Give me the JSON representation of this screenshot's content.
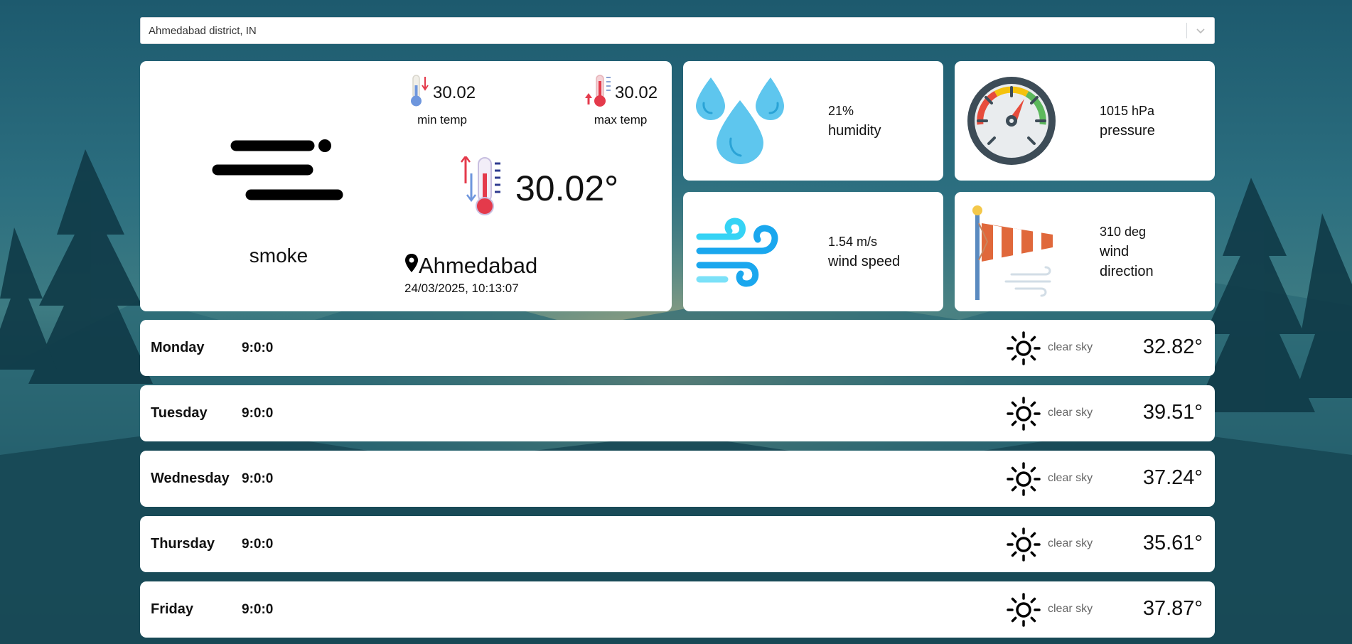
{
  "search": {
    "value": "Ahmedabad district, IN"
  },
  "current": {
    "condition": "smoke",
    "min_temp": "30.02",
    "min_label": "min temp",
    "max_temp": "30.02",
    "max_label": "max temp",
    "temp": "30.02°",
    "city": "Ahmedabad",
    "datetime": "24/03/2025, 10:13:07"
  },
  "tiles": {
    "humidity": {
      "value": "21%",
      "label": "humidity"
    },
    "pressure": {
      "value": "1015 hPa",
      "label": "pressure"
    },
    "wind_speed": {
      "value": "1.54 m/s",
      "label": "wind speed"
    },
    "wind_direction": {
      "value": "310 deg",
      "label_line1": "wind",
      "label_line2": "direction"
    }
  },
  "forecast": [
    {
      "day": "Monday",
      "time": "9:0:0",
      "desc": "clear sky",
      "temp": "32.82°"
    },
    {
      "day": "Tuesday",
      "time": "9:0:0",
      "desc": "clear sky",
      "temp": "39.51°"
    },
    {
      "day": "Wednesday",
      "time": "9:0:0",
      "desc": "clear sky",
      "temp": "37.24°"
    },
    {
      "day": "Thursday",
      "time": "9:0:0",
      "desc": "clear sky",
      "temp": "35.61°"
    },
    {
      "day": "Friday",
      "time": "9:0:0",
      "desc": "clear sky",
      "temp": "37.87°"
    }
  ],
  "icons": {
    "select_chevron": "chevron-down-icon",
    "condition": "smoke-icon",
    "min": "thermometer-low-icon",
    "max": "thermometer-high-icon",
    "current": "thermometer-icon",
    "location": "location-pin-icon",
    "humidity": "water-drops-icon",
    "pressure": "gauge-icon",
    "wind_speed": "wind-icon",
    "wind_direction": "windsock-icon",
    "forecast": "sun-icon"
  },
  "colors": {
    "card_bg": "#ffffff",
    "page_bg": "#1d5a6e",
    "drop": "#5ec6ee",
    "gauge_ring": "#3d4c57",
    "wind": "#1aa7ee",
    "windsock": "#e0683b"
  }
}
